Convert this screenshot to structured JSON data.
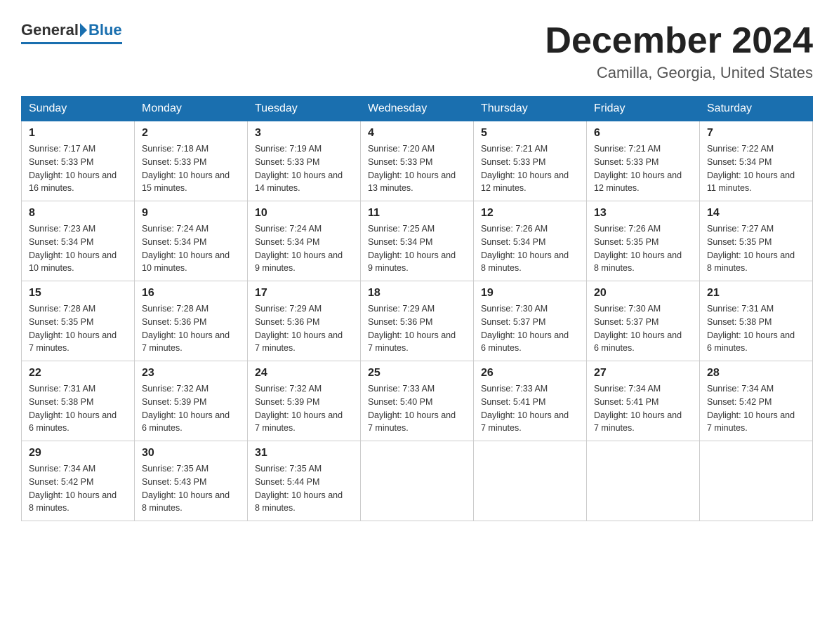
{
  "header": {
    "logo": {
      "general": "General",
      "blue": "Blue"
    },
    "title": "December 2024",
    "location": "Camilla, Georgia, United States"
  },
  "days_of_week": [
    "Sunday",
    "Monday",
    "Tuesday",
    "Wednesday",
    "Thursday",
    "Friday",
    "Saturday"
  ],
  "weeks": [
    [
      {
        "day": "1",
        "sunrise": "7:17 AM",
        "sunset": "5:33 PM",
        "daylight": "10 hours and 16 minutes."
      },
      {
        "day": "2",
        "sunrise": "7:18 AM",
        "sunset": "5:33 PM",
        "daylight": "10 hours and 15 minutes."
      },
      {
        "day": "3",
        "sunrise": "7:19 AM",
        "sunset": "5:33 PM",
        "daylight": "10 hours and 14 minutes."
      },
      {
        "day": "4",
        "sunrise": "7:20 AM",
        "sunset": "5:33 PM",
        "daylight": "10 hours and 13 minutes."
      },
      {
        "day": "5",
        "sunrise": "7:21 AM",
        "sunset": "5:33 PM",
        "daylight": "10 hours and 12 minutes."
      },
      {
        "day": "6",
        "sunrise": "7:21 AM",
        "sunset": "5:33 PM",
        "daylight": "10 hours and 12 minutes."
      },
      {
        "day": "7",
        "sunrise": "7:22 AM",
        "sunset": "5:34 PM",
        "daylight": "10 hours and 11 minutes."
      }
    ],
    [
      {
        "day": "8",
        "sunrise": "7:23 AM",
        "sunset": "5:34 PM",
        "daylight": "10 hours and 10 minutes."
      },
      {
        "day": "9",
        "sunrise": "7:24 AM",
        "sunset": "5:34 PM",
        "daylight": "10 hours and 10 minutes."
      },
      {
        "day": "10",
        "sunrise": "7:24 AM",
        "sunset": "5:34 PM",
        "daylight": "10 hours and 9 minutes."
      },
      {
        "day": "11",
        "sunrise": "7:25 AM",
        "sunset": "5:34 PM",
        "daylight": "10 hours and 9 minutes."
      },
      {
        "day": "12",
        "sunrise": "7:26 AM",
        "sunset": "5:34 PM",
        "daylight": "10 hours and 8 minutes."
      },
      {
        "day": "13",
        "sunrise": "7:26 AM",
        "sunset": "5:35 PM",
        "daylight": "10 hours and 8 minutes."
      },
      {
        "day": "14",
        "sunrise": "7:27 AM",
        "sunset": "5:35 PM",
        "daylight": "10 hours and 8 minutes."
      }
    ],
    [
      {
        "day": "15",
        "sunrise": "7:28 AM",
        "sunset": "5:35 PM",
        "daylight": "10 hours and 7 minutes."
      },
      {
        "day": "16",
        "sunrise": "7:28 AM",
        "sunset": "5:36 PM",
        "daylight": "10 hours and 7 minutes."
      },
      {
        "day": "17",
        "sunrise": "7:29 AM",
        "sunset": "5:36 PM",
        "daylight": "10 hours and 7 minutes."
      },
      {
        "day": "18",
        "sunrise": "7:29 AM",
        "sunset": "5:36 PM",
        "daylight": "10 hours and 7 minutes."
      },
      {
        "day": "19",
        "sunrise": "7:30 AM",
        "sunset": "5:37 PM",
        "daylight": "10 hours and 6 minutes."
      },
      {
        "day": "20",
        "sunrise": "7:30 AM",
        "sunset": "5:37 PM",
        "daylight": "10 hours and 6 minutes."
      },
      {
        "day": "21",
        "sunrise": "7:31 AM",
        "sunset": "5:38 PM",
        "daylight": "10 hours and 6 minutes."
      }
    ],
    [
      {
        "day": "22",
        "sunrise": "7:31 AM",
        "sunset": "5:38 PM",
        "daylight": "10 hours and 6 minutes."
      },
      {
        "day": "23",
        "sunrise": "7:32 AM",
        "sunset": "5:39 PM",
        "daylight": "10 hours and 6 minutes."
      },
      {
        "day": "24",
        "sunrise": "7:32 AM",
        "sunset": "5:39 PM",
        "daylight": "10 hours and 7 minutes."
      },
      {
        "day": "25",
        "sunrise": "7:33 AM",
        "sunset": "5:40 PM",
        "daylight": "10 hours and 7 minutes."
      },
      {
        "day": "26",
        "sunrise": "7:33 AM",
        "sunset": "5:41 PM",
        "daylight": "10 hours and 7 minutes."
      },
      {
        "day": "27",
        "sunrise": "7:34 AM",
        "sunset": "5:41 PM",
        "daylight": "10 hours and 7 minutes."
      },
      {
        "day": "28",
        "sunrise": "7:34 AM",
        "sunset": "5:42 PM",
        "daylight": "10 hours and 7 minutes."
      }
    ],
    [
      {
        "day": "29",
        "sunrise": "7:34 AM",
        "sunset": "5:42 PM",
        "daylight": "10 hours and 8 minutes."
      },
      {
        "day": "30",
        "sunrise": "7:35 AM",
        "sunset": "5:43 PM",
        "daylight": "10 hours and 8 minutes."
      },
      {
        "day": "31",
        "sunrise": "7:35 AM",
        "sunset": "5:44 PM",
        "daylight": "10 hours and 8 minutes."
      },
      null,
      null,
      null,
      null
    ]
  ],
  "labels": {
    "sunrise": "Sunrise:",
    "sunset": "Sunset:",
    "daylight": "Daylight:"
  }
}
